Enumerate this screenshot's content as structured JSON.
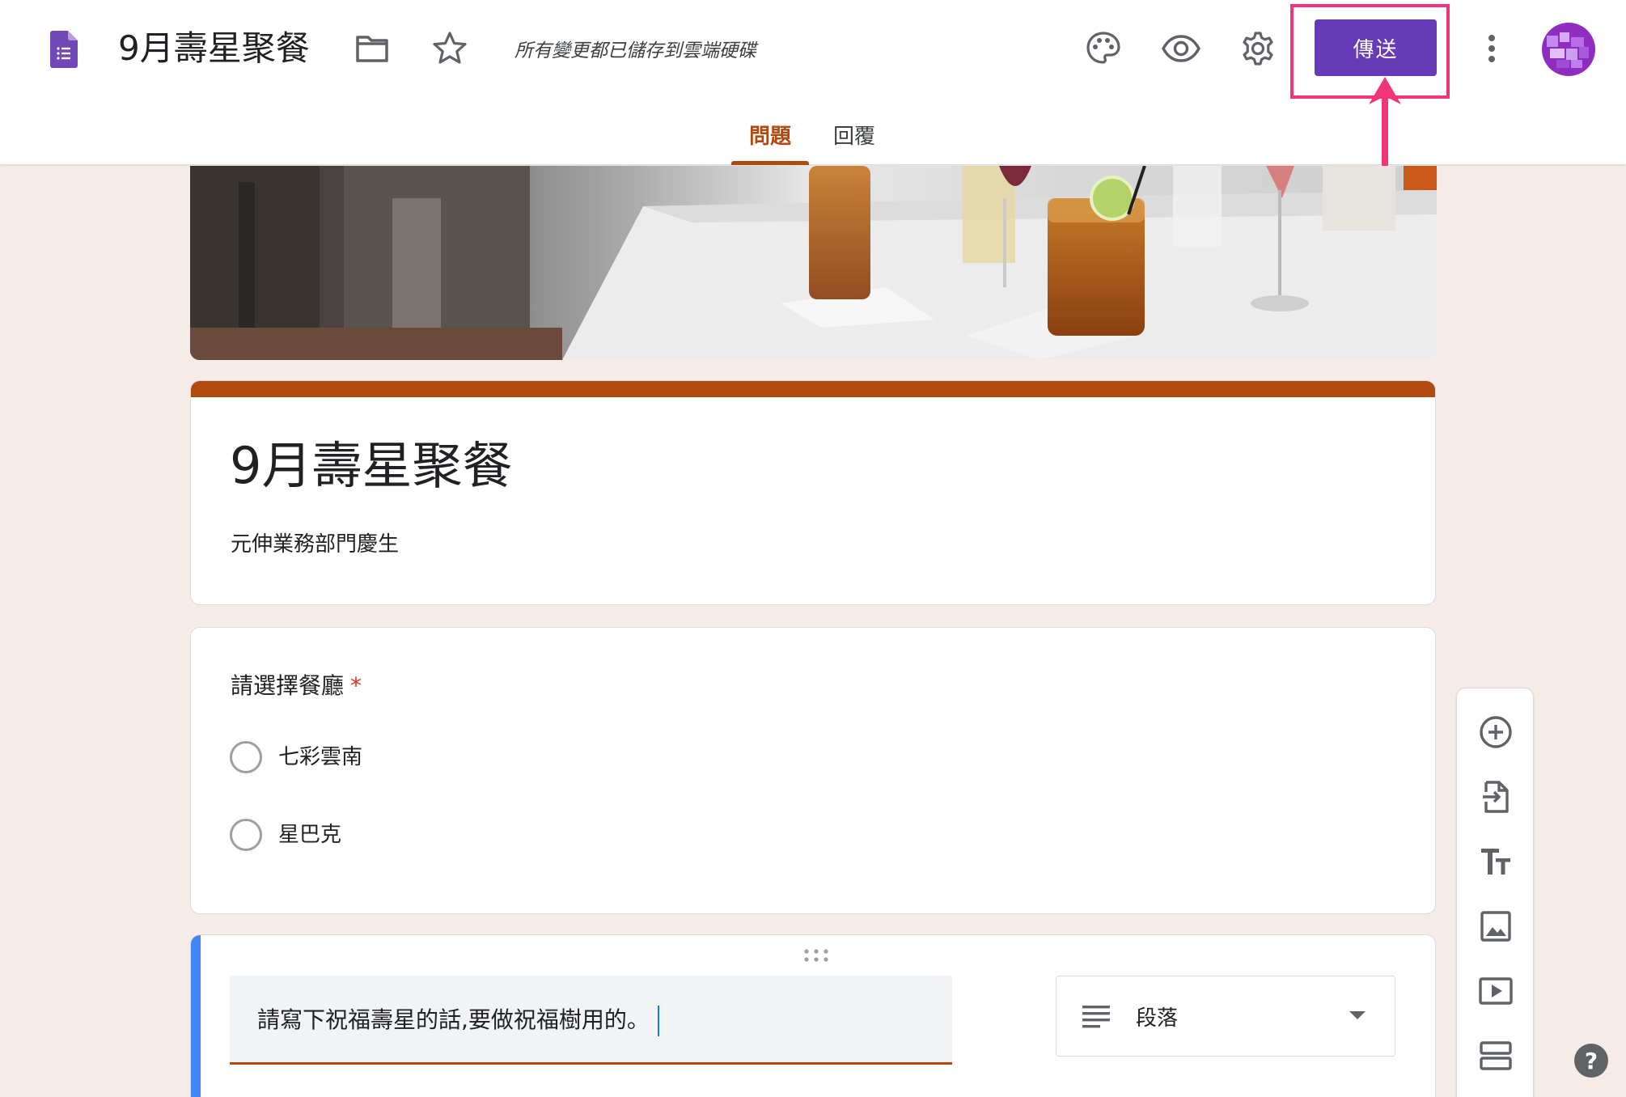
{
  "header": {
    "doc_title": "9月壽星聚餐",
    "save_status": "所有變更都已儲存到雲端硬碟",
    "send_label": "傳送",
    "icons": [
      "forms-logo-icon",
      "folder-icon",
      "star-icon",
      "palette-icon",
      "eye-icon",
      "gear-icon",
      "more-vert-icon"
    ],
    "accent_color": "#673ab7",
    "highlight_color": "#f2357a"
  },
  "tabs": [
    {
      "label": "問題",
      "active": true
    },
    {
      "label": "回覆",
      "active": false
    }
  ],
  "form": {
    "title": "9月壽星聚餐",
    "description": "元伸業務部門慶生",
    "theme_color": "#b04a0f",
    "background_color": "#f5ece7"
  },
  "question1": {
    "title": "請選擇餐廳",
    "required_mark": "*",
    "options": [
      "七彩雲南",
      "星巴克"
    ]
  },
  "question2": {
    "title": "請寫下祝福壽星的話,要做祝福樹用的。",
    "type_label": "段落"
  },
  "side_toolbar": [
    "add-question-icon",
    "import-questions-icon",
    "add-title-icon",
    "add-image-icon",
    "add-video-icon",
    "add-section-icon"
  ],
  "help_label": "?"
}
